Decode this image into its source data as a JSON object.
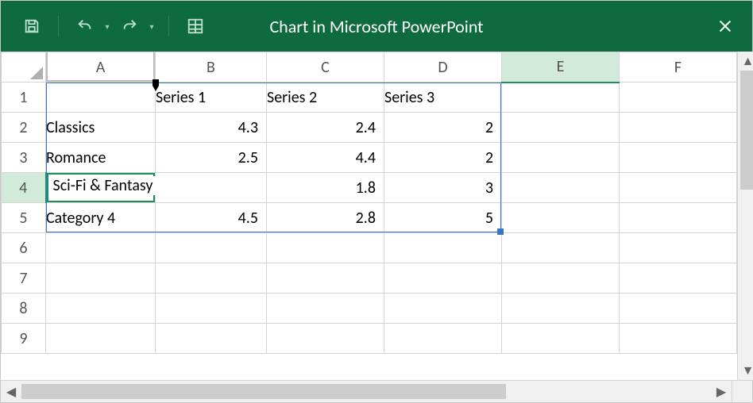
{
  "titlebar": {
    "title": "Chart in Microsoft PowerPoint"
  },
  "columns": [
    "A",
    "B",
    "C",
    "D",
    "E",
    "F"
  ],
  "rows": [
    "1",
    "2",
    "3",
    "4",
    "5",
    "6",
    "7",
    "8",
    "9"
  ],
  "headerRow": {
    "b": "Series 1",
    "c": "Series 2",
    "d": "Series 3"
  },
  "dataRows": [
    {
      "a": "Classics",
      "b": "4.3",
      "c": "2.4",
      "d": "2"
    },
    {
      "a": "Romance",
      "b": "2.5",
      "c": "4.4",
      "d": "2"
    },
    {
      "a": "Sci-Fi & Fantasy",
      "b": "",
      "c": "1.8",
      "d": "3"
    },
    {
      "a": "Category 4",
      "b": "4.5",
      "c": "2.8",
      "d": "5"
    }
  ],
  "editing": {
    "cell": "A4",
    "value": "Sci-Fi & Fantasy"
  },
  "selectedColumn": "E",
  "selectedRow": "4",
  "chart_data": {
    "type": "bar",
    "categories": [
      "Classics",
      "Romance",
      "Sci-Fi & Fantasy",
      "Category 4"
    ],
    "series": [
      {
        "name": "Series 1",
        "values": [
          4.3,
          2.5,
          null,
          4.5
        ]
      },
      {
        "name": "Series 2",
        "values": [
          2.4,
          4.4,
          1.8,
          2.8
        ]
      },
      {
        "name": "Series 3",
        "values": [
          2,
          2,
          3,
          5
        ]
      }
    ],
    "title": "",
    "xlabel": "",
    "ylabel": ""
  }
}
